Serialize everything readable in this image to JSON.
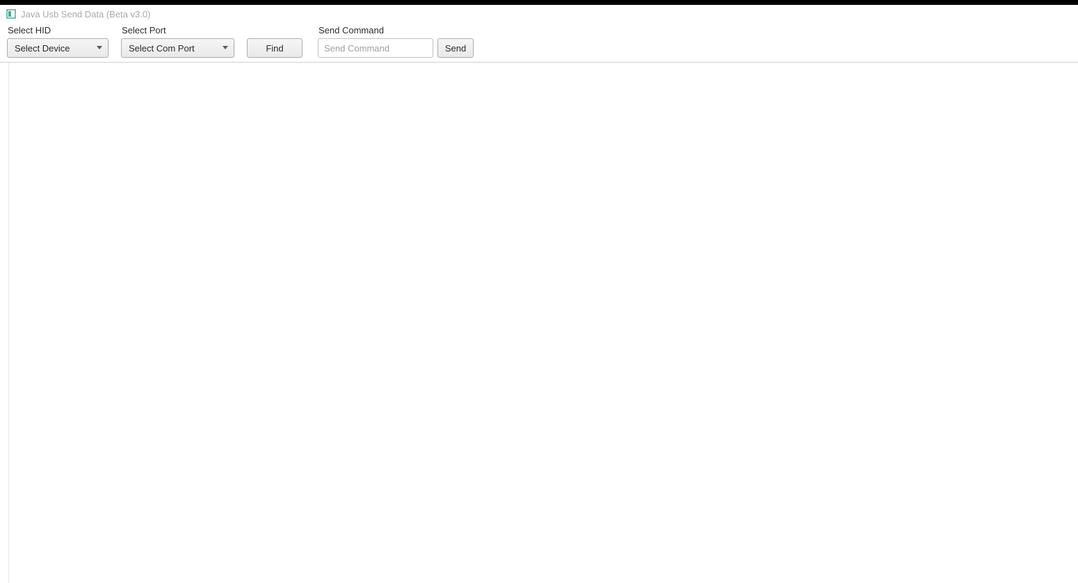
{
  "window": {
    "title": "Java Usb Send Data (Beta v3.0)"
  },
  "toolbar": {
    "hid": {
      "label": "Select HID",
      "selected": "Select Device"
    },
    "port": {
      "label": "Select Port",
      "selected": "Select Com Port"
    },
    "find_label": "Find",
    "command": {
      "label": "Send Command",
      "placeholder": "Send Command",
      "value": ""
    },
    "send_label": "Send"
  }
}
